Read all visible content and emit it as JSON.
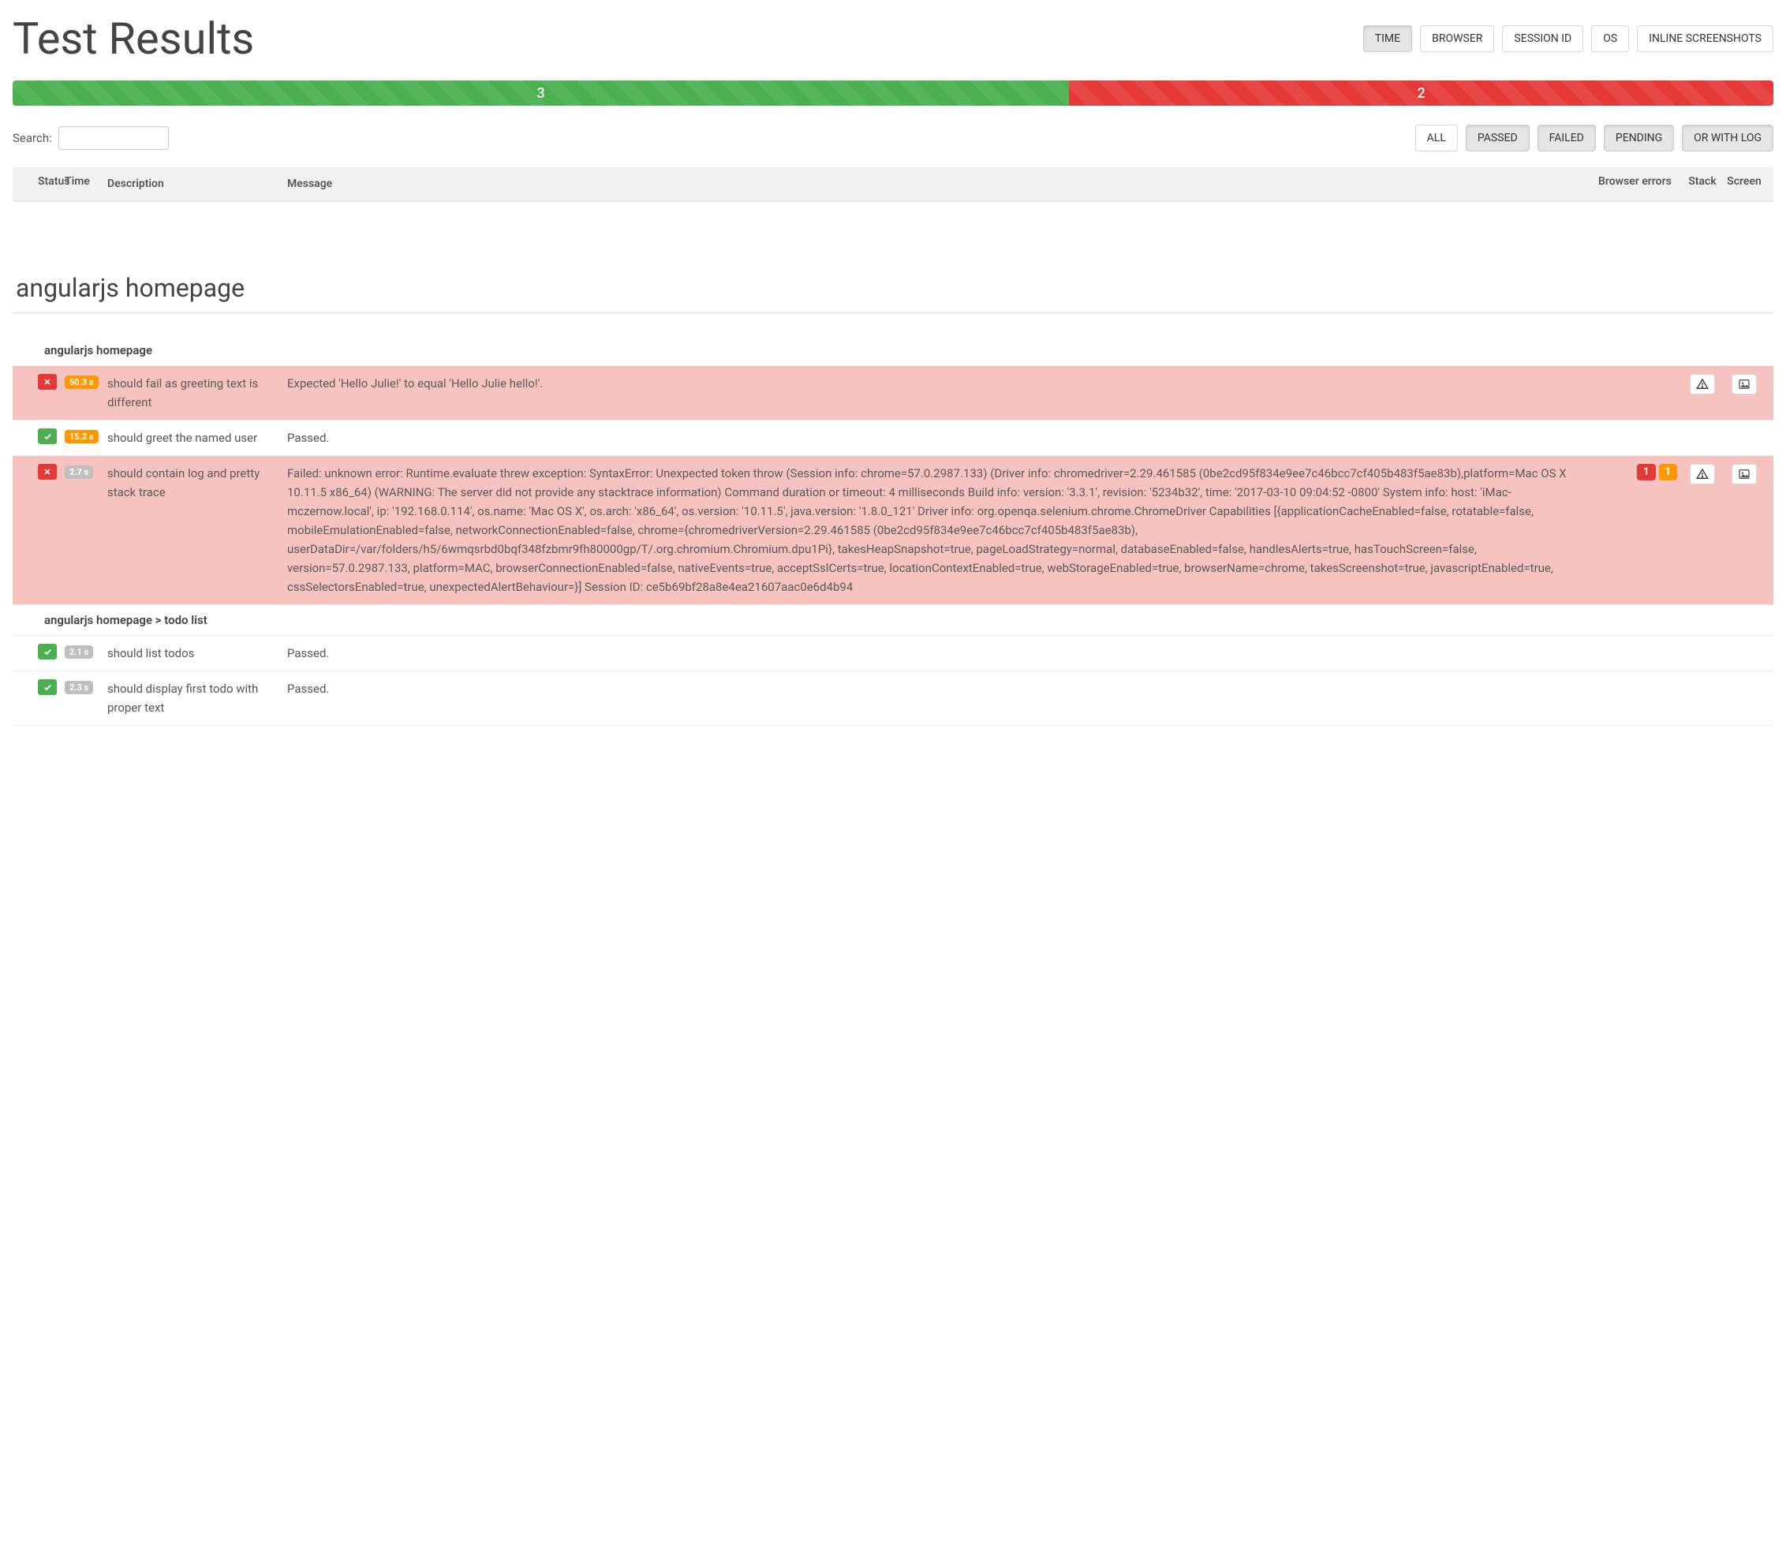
{
  "header": {
    "title": "Test Results",
    "options": [
      "TIME",
      "BROWSER",
      "SESSION ID",
      "OS",
      "INLINE SCREENSHOTS"
    ],
    "active_option": "TIME"
  },
  "progress": {
    "pass": 3,
    "fail": 2,
    "pass_pct": 60,
    "fail_pct": 40
  },
  "search": {
    "label": "Search:",
    "value": ""
  },
  "filters": [
    "ALL",
    "PASSED",
    "FAILED",
    "PENDING",
    "OR WITH LOG"
  ],
  "active_filter": "",
  "columns": {
    "status": "Status",
    "time": "Time",
    "description": "Description",
    "message": "Message",
    "browser_errors": "Browser errors",
    "stack": "Stack",
    "screen": "Screen"
  },
  "section": {
    "title": "angularjs homepage"
  },
  "groups": [
    {
      "title": "angularjs homepage",
      "tests": [
        {
          "status": "fail",
          "time": "50.3 s",
          "time_color": "orange",
          "description": "should fail as greeting text is different",
          "message": "Expected 'Hello Julie!' to equal 'Hello Julie hello!'.",
          "browser_counts": [],
          "has_stack": true,
          "has_screen": true
        },
        {
          "status": "pass",
          "time": "15.2 s",
          "time_color": "orange",
          "description": "should greet the named user",
          "message": "Passed.",
          "browser_counts": [],
          "has_stack": false,
          "has_screen": false
        },
        {
          "status": "fail",
          "time": "2.7 s",
          "time_color": "gray",
          "description": "should contain log and pretty stack trace",
          "message": "Failed: unknown error: Runtime.evaluate threw exception: SyntaxError: Unexpected token throw (Session info: chrome=57.0.2987.133) (Driver info: chromedriver=2.29.461585 (0be2cd95f834e9ee7c46bcc7cf405b483f5ae83b),platform=Mac OS X 10.11.5 x86_64) (WARNING: The server did not provide any stacktrace information) Command duration or timeout: 4 milliseconds Build info: version: '3.3.1', revision: '5234b32', time: '2017-03-10 09:04:52 -0800' System info: host: 'iMac-mczernow.local', ip: '192.168.0.114', os.name: 'Mac OS X', os.arch: 'x86_64', os.version: '10.11.5', java.version: '1.8.0_121' Driver info: org.openqa.selenium.chrome.ChromeDriver Capabilities [{applicationCacheEnabled=false, rotatable=false, mobileEmulationEnabled=false, networkConnectionEnabled=false, chrome={chromedriverVersion=2.29.461585 (0be2cd95f834e9ee7c46bcc7cf405b483f5ae83b), userDataDir=/var/folders/h5/6wmqsrbd0bqf348fzbmr9fh80000gp/T/.org.chromium.Chromium.dpu1Pi}, takesHeapSnapshot=true, pageLoadStrategy=normal, databaseEnabled=false, handlesAlerts=true, hasTouchScreen=false, version=57.0.2987.133, platform=MAC, browserConnectionEnabled=false, nativeEvents=true, acceptSslCerts=true, locationContextEnabled=true, webStorageEnabled=true, browserName=chrome, takesScreenshot=true, javascriptEnabled=true, cssSelectorsEnabled=true, unexpectedAlertBehaviour=}] Session ID: ce5b69bf28a8e4ea21607aac0e6d4b94",
          "browser_counts": [
            {
              "value": "1",
              "color": "red"
            },
            {
              "value": "1",
              "color": "orange"
            }
          ],
          "has_stack": true,
          "has_screen": true
        }
      ]
    },
    {
      "title": "angularjs homepage > todo list",
      "tests": [
        {
          "status": "pass",
          "time": "2.1 s",
          "time_color": "gray",
          "description": "should list todos",
          "message": "Passed.",
          "browser_counts": [],
          "has_stack": false,
          "has_screen": false
        },
        {
          "status": "pass",
          "time": "2.3 s",
          "time_color": "gray",
          "description": "should display first todo with proper text",
          "message": "Passed.",
          "browser_counts": [],
          "has_stack": false,
          "has_screen": false
        }
      ]
    }
  ]
}
